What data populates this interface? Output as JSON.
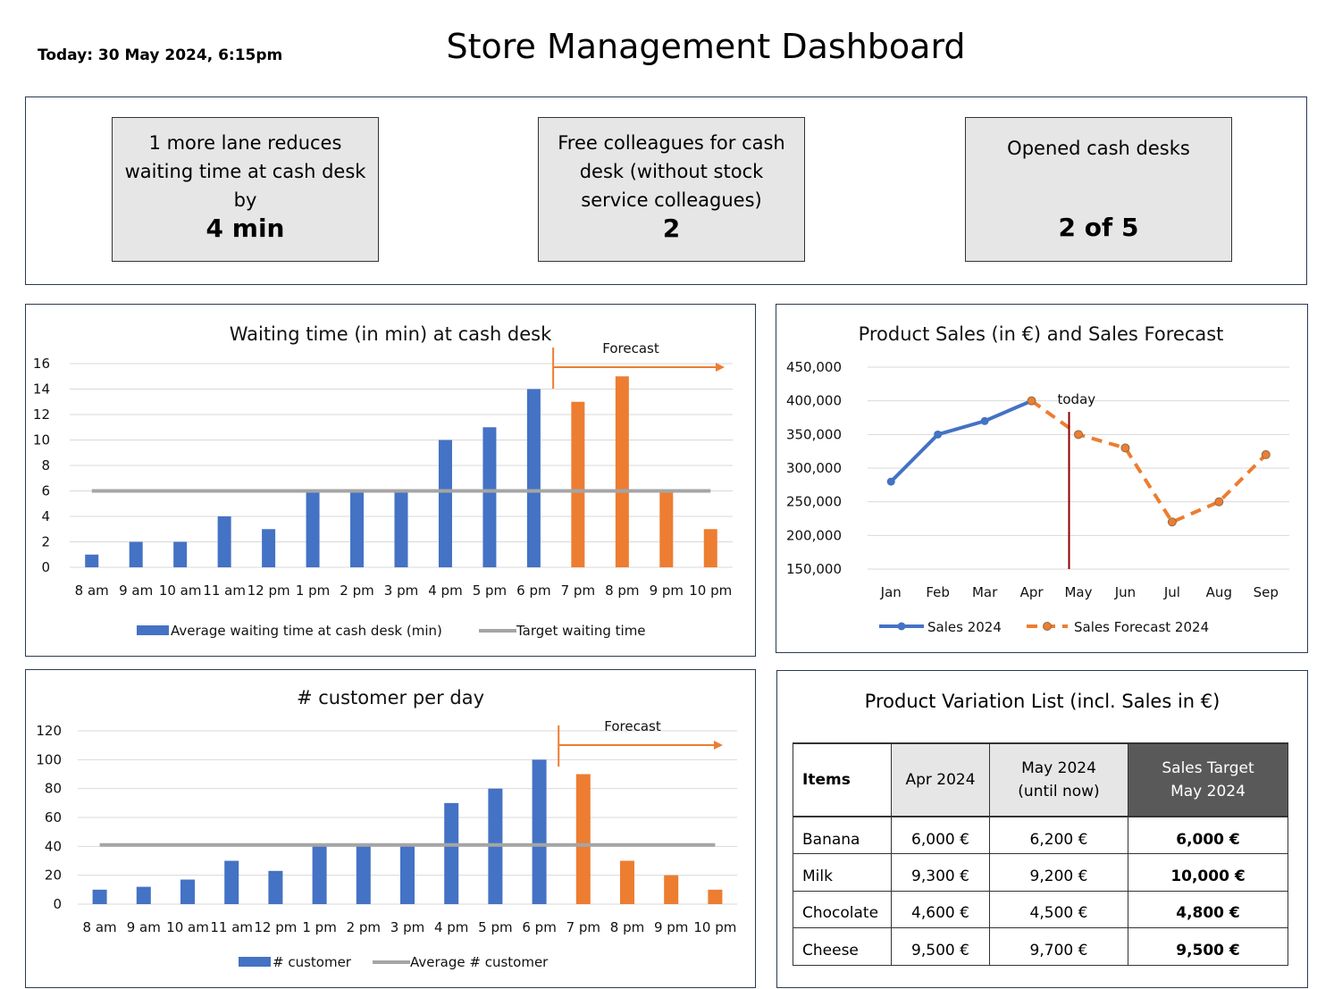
{
  "header": {
    "date": "Today: 30 May 2024, 6:15pm",
    "title": "Store Management Dashboard"
  },
  "kpis": [
    {
      "label_lines": [
        "1 more lane reduces",
        "waiting time at cash desk",
        "by"
      ],
      "value": "4 min"
    },
    {
      "label_lines": [
        "Free colleagues for cash",
        "desk (without stock",
        "service colleagues)"
      ],
      "value": "2"
    },
    {
      "label_lines": [
        "Opened cash desks"
      ],
      "value": "2 of 5"
    }
  ],
  "chart_data": [
    {
      "type": "bar",
      "title": "Waiting time (in min) at cash desk",
      "categories": [
        "8 am",
        "9 am",
        "10 am",
        "11 am",
        "12 pm",
        "1 pm",
        "2 pm",
        "3 pm",
        "4 pm",
        "5 pm",
        "6 pm",
        "7 pm",
        "8 pm",
        "9 pm",
        "10 pm"
      ],
      "series": [
        {
          "name": "Average waiting time at cash desk (min)",
          "values": [
            1,
            2,
            2,
            4,
            3,
            6,
            6,
            6,
            10,
            11,
            14,
            13,
            15,
            6,
            3
          ]
        },
        {
          "name": "Target waiting time",
          "type": "line",
          "values": [
            6,
            6,
            6,
            6,
            6,
            6,
            6,
            6,
            6,
            6,
            6,
            6,
            6,
            6,
            6
          ]
        }
      ],
      "forecast_start_index": 11,
      "forecast_label": "Forecast",
      "ylim": [
        0,
        16
      ],
      "yticks": [
        0,
        2,
        4,
        6,
        8,
        10,
        12,
        14,
        16
      ],
      "colors": {
        "actual": "#4472c4",
        "forecast": "#ed7d31",
        "target": "#a5a5a5"
      }
    },
    {
      "type": "line",
      "title": "Product Sales (in €) and Sales Forecast",
      "categories": [
        "Jan",
        "Feb",
        "Mar",
        "Apr",
        "May",
        "Jun",
        "Jul",
        "Aug",
        "Sep"
      ],
      "series": [
        {
          "name": "Sales 2024",
          "values": [
            280000,
            350000,
            370000,
            400000,
            null,
            null,
            null,
            null,
            null
          ]
        },
        {
          "name": "Sales Forecast 2024",
          "values": [
            null,
            null,
            null,
            400000,
            350000,
            330000,
            220000,
            250000,
            320000
          ]
        }
      ],
      "today_label": "today",
      "ylim": [
        150000,
        450000
      ],
      "yticks": [
        150000,
        200000,
        250000,
        300000,
        350000,
        400000,
        450000
      ],
      "ytick_labels": [
        "150,000",
        "200,000",
        "250,000",
        "300,000",
        "350,000",
        "400,000",
        "450,000"
      ],
      "colors": {
        "sales": "#4472c4",
        "forecast": "#ed7d31",
        "today": "#8b0000"
      }
    },
    {
      "type": "bar",
      "title": "# customer per day",
      "categories": [
        "8 am",
        "9 am",
        "10 am",
        "11 am",
        "12 pm",
        "1 pm",
        "2 pm",
        "3 pm",
        "4 pm",
        "5 pm",
        "6 pm",
        "7 pm",
        "8 pm",
        "9 pm",
        "10 pm"
      ],
      "series": [
        {
          "name": "# customer",
          "values": [
            10,
            12,
            17,
            30,
            23,
            40,
            40,
            40,
            70,
            80,
            100,
            90,
            30,
            20,
            10
          ]
        },
        {
          "name": "Average # customer",
          "type": "line",
          "values": [
            41,
            41,
            41,
            41,
            41,
            41,
            41,
            41,
            41,
            41,
            41,
            41,
            41,
            41,
            41
          ]
        }
      ],
      "forecast_start_index": 11,
      "forecast_label": "Forecast",
      "ylim": [
        0,
        120
      ],
      "yticks": [
        0,
        20,
        40,
        60,
        80,
        100,
        120
      ],
      "colors": {
        "actual": "#4472c4",
        "forecast": "#ed7d31",
        "target": "#a5a5a5"
      }
    },
    {
      "type": "table",
      "title": "Product Variation List (incl. Sales in €)",
      "columns": [
        "Items",
        "Apr 2024",
        "May 2024\n(until  now)",
        "Sales Target\nMay 2024"
      ],
      "rows": [
        [
          "Banana",
          "6,000 €",
          "6,200 €",
          "6,000 €"
        ],
        [
          "Milk",
          "9,300 €",
          "9,200 €",
          "10,000 €"
        ],
        [
          "Chocolate",
          "4,600 €",
          "4,500 €",
          "4,800 €"
        ],
        [
          "Cheese",
          "9,500 €",
          "9,700 €",
          "9,500 €"
        ]
      ]
    }
  ]
}
